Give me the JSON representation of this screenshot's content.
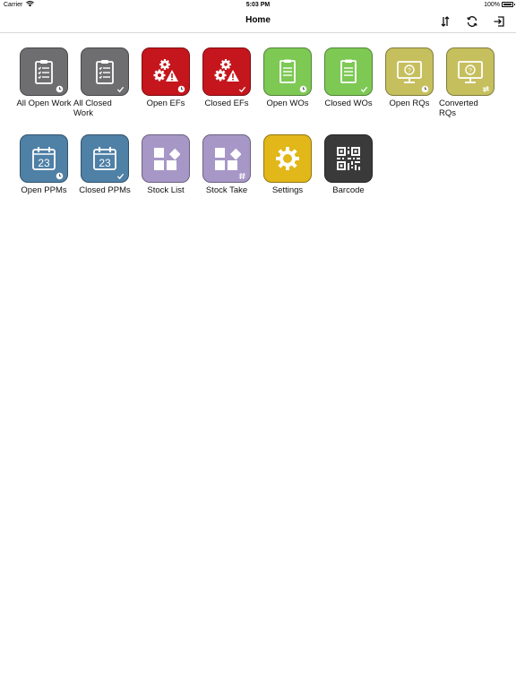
{
  "status": {
    "carrier": "Carrier",
    "time": "5:03 PM",
    "battery": "100%",
    "battery_level": 1.0
  },
  "nav": {
    "title": "Home",
    "actions": [
      {
        "name": "sort-icon"
      },
      {
        "name": "sync-icon"
      },
      {
        "name": "logout-icon"
      }
    ]
  },
  "tiles": [
    {
      "label": "All Open Work",
      "color": "#6e6e70",
      "icon": "clipboard-icon",
      "badge": "clock"
    },
    {
      "label": "All Closed Work",
      "color": "#6e6e70",
      "icon": "clipboard-icon",
      "badge": "check"
    },
    {
      "label": "Open EFs",
      "color": "#c4161c",
      "icon": "gears-warning-icon",
      "badge": "clock"
    },
    {
      "label": "Closed EFs",
      "color": "#c4161c",
      "icon": "gears-warning-icon",
      "badge": "check"
    },
    {
      "label": "Open WOs",
      "color": "#7dc954",
      "icon": "document-icon",
      "badge": "clock"
    },
    {
      "label": "Closed WOs",
      "color": "#7dc954",
      "icon": "document-icon",
      "badge": "check"
    },
    {
      "label": "Open RQs",
      "color": "#c6bf5e",
      "icon": "monitor-question-icon",
      "badge": "clock"
    },
    {
      "label": "Converted RQs",
      "color": "#c6bf5e",
      "icon": "monitor-question-icon",
      "badge": "convert"
    },
    {
      "label": "Open PPMs",
      "color": "#4f80a6",
      "icon": "calendar-icon",
      "badge": "clock",
      "calendar_day": "23"
    },
    {
      "label": "Closed PPMs",
      "color": "#4f80a6",
      "icon": "calendar-icon",
      "badge": "check",
      "calendar_day": "23"
    },
    {
      "label": "Stock List",
      "color": "#a797c6",
      "icon": "blocks-icon",
      "badge": ""
    },
    {
      "label": "Stock Take",
      "color": "#a797c6",
      "icon": "blocks-icon",
      "badge": "hash"
    },
    {
      "label": "Settings",
      "color": "#e1b719",
      "icon": "gear-icon",
      "badge": ""
    },
    {
      "label": "Barcode",
      "color": "#3a3a3a",
      "icon": "qr-code-icon",
      "badge": ""
    }
  ]
}
